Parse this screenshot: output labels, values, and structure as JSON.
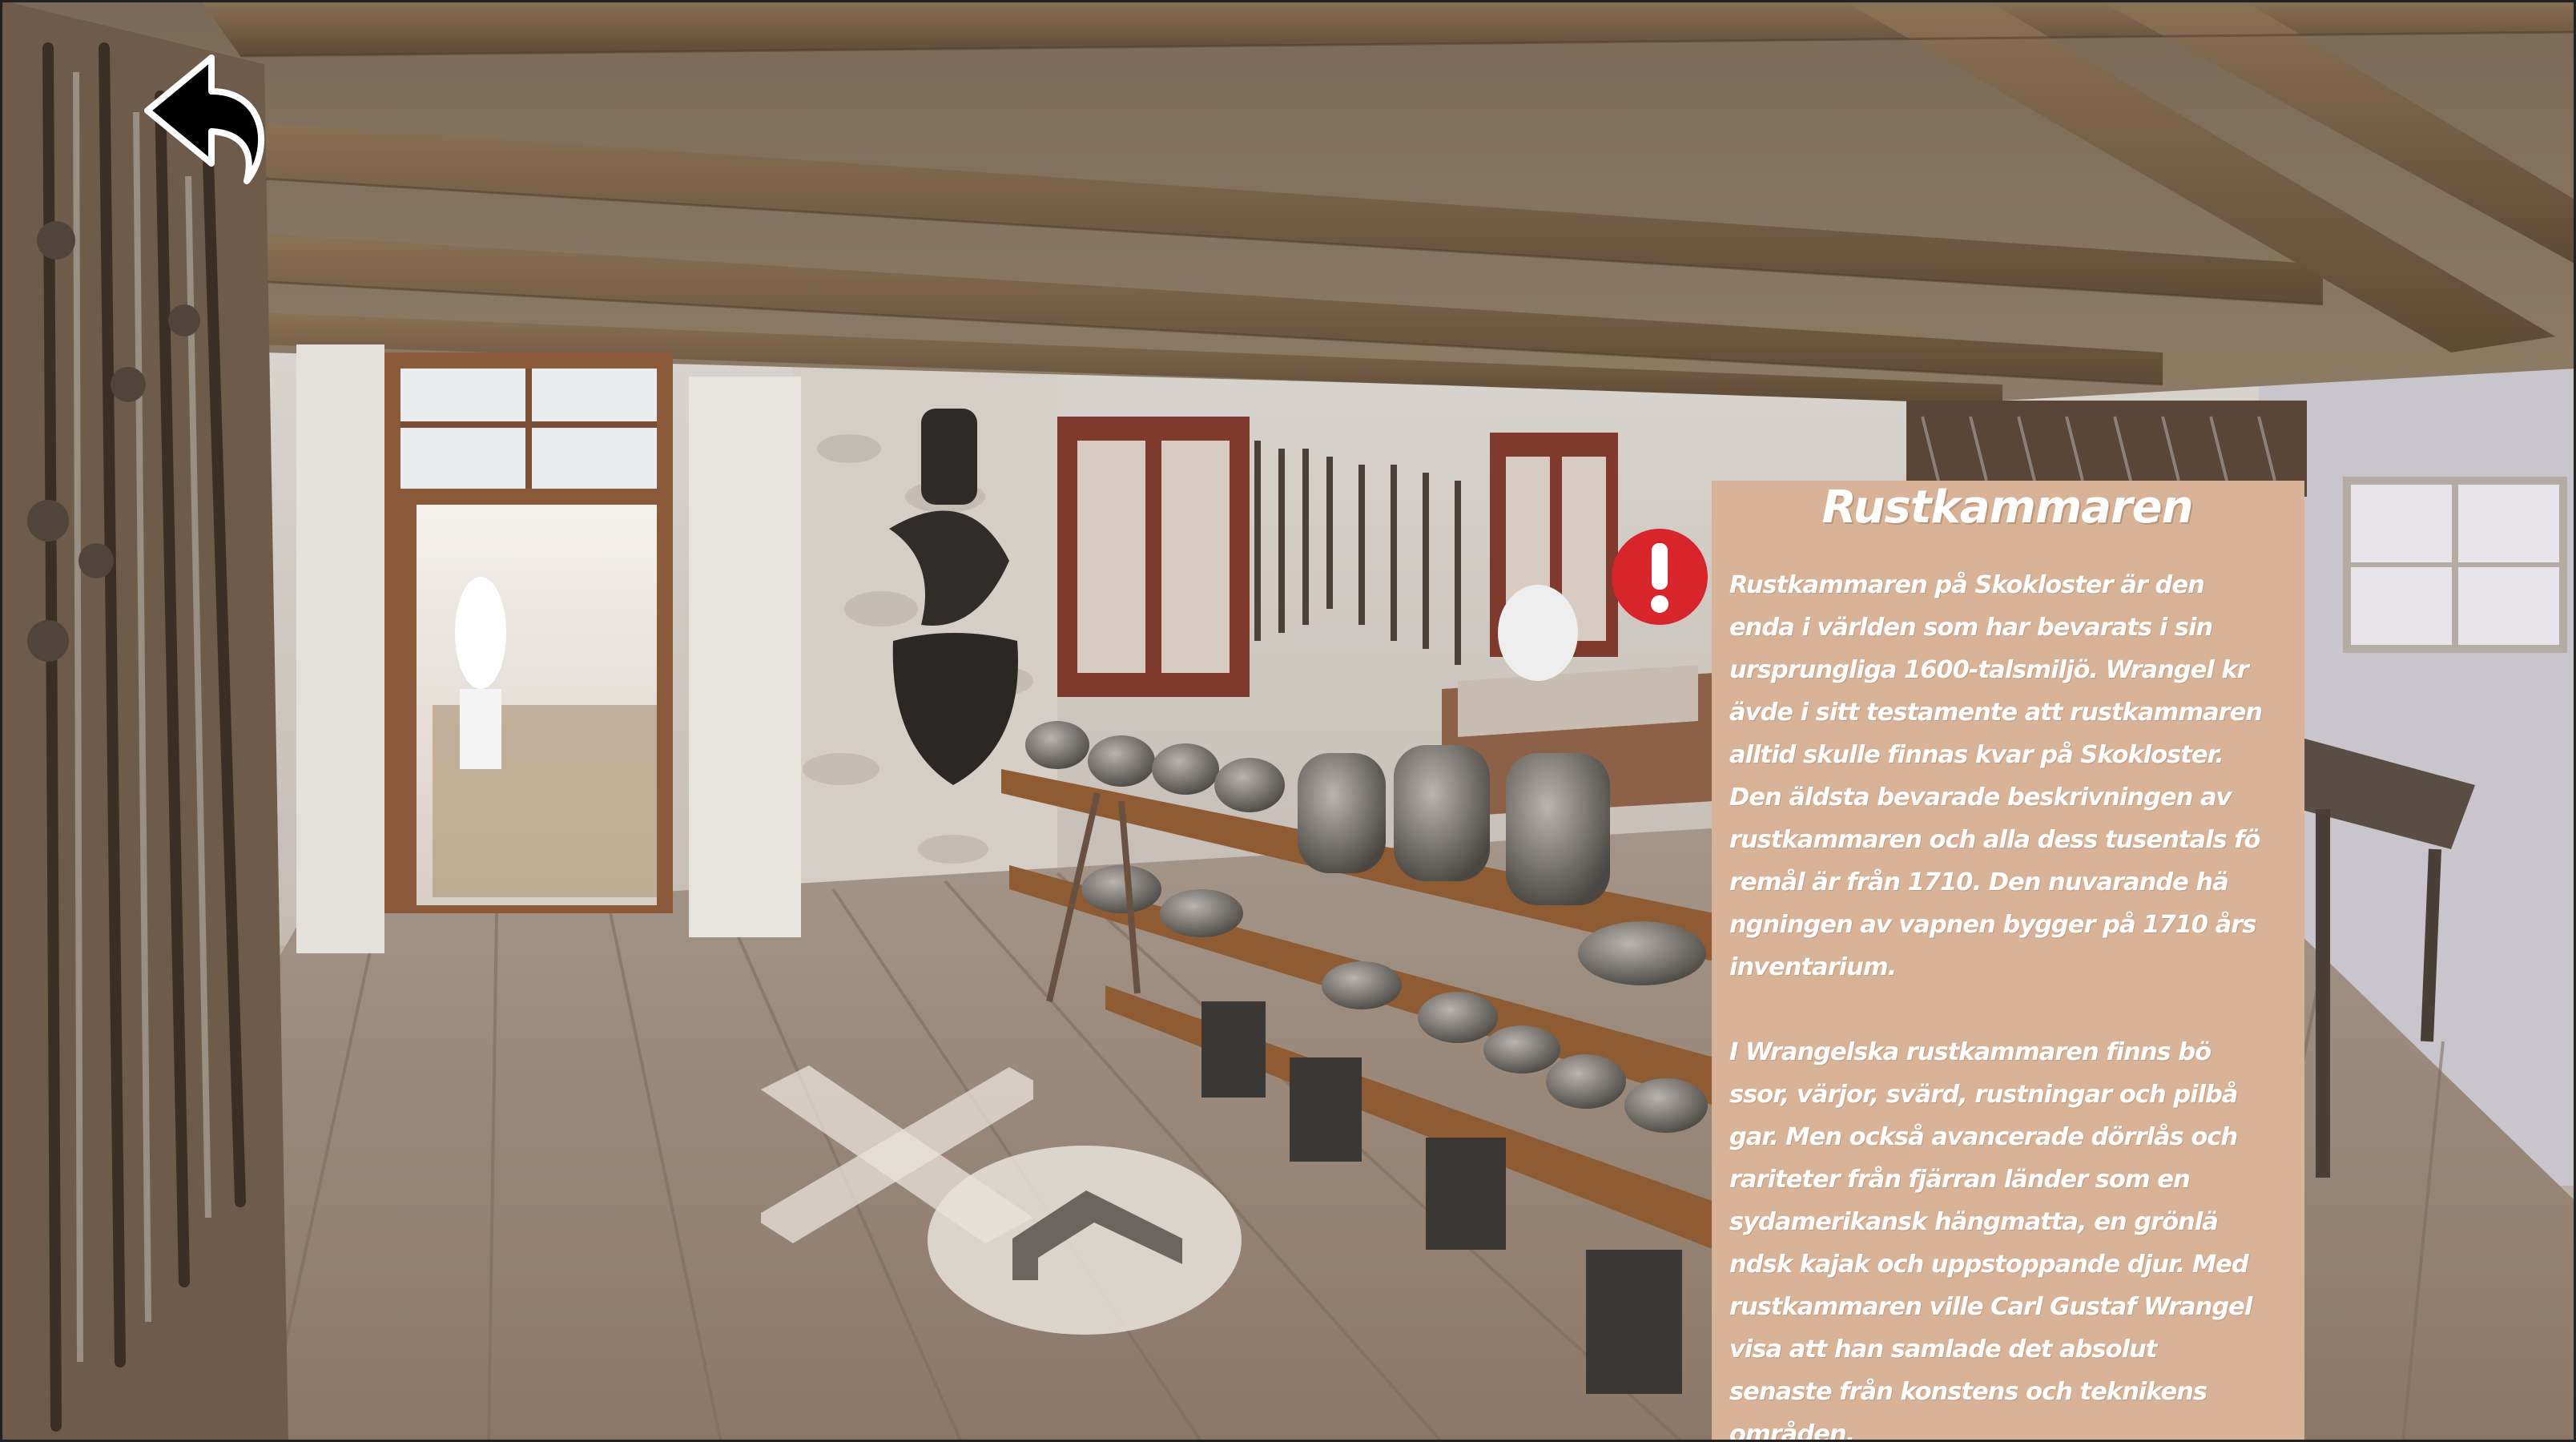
{
  "panel": {
    "title": "Rustkammaren",
    "paragraph_1": "Rustkammaren på Skokloster är den\nenda i världen som har bevarats i sin\nursprungliga 1600-talsmiljö. Wrangel kr\nävde i sitt testamente att rustkammaren\nalltid skulle finnas kvar på Skokloster.\nDen äldsta bevarade beskrivningen av\nrustkammaren och alla dess tusentals fö\nremål är från 1710. Den nuvarande hä\nngningen av vapnen bygger på 1710 års\ninventarium.",
    "paragraph_2": "I Wrangelska rustkammaren finns bö\nssor, värjor, svärd, rustningar och pilbå\ngar. Men också avancerade dörrlås och\nrariteter från fjärran länder som en\nsydamerikansk hängmatta, en grönlä\nndsk kajak och uppstoppande djur. Med\nrustkammaren ville Carl Gustaf Wrangel\n visa att han samlade det absolut\nsenaste från konstens och teknikens\nområden."
  },
  "icons": {
    "back": "undo-arrow-icon",
    "alert": "exclamation-icon",
    "close": "x-icon",
    "forward": "chevron-up-icon"
  },
  "colors": {
    "panel_background": "#d9b397",
    "panel_text": "#ffffff",
    "alert_red": "#d8252c",
    "nav_marker": "#e8e3dc"
  }
}
